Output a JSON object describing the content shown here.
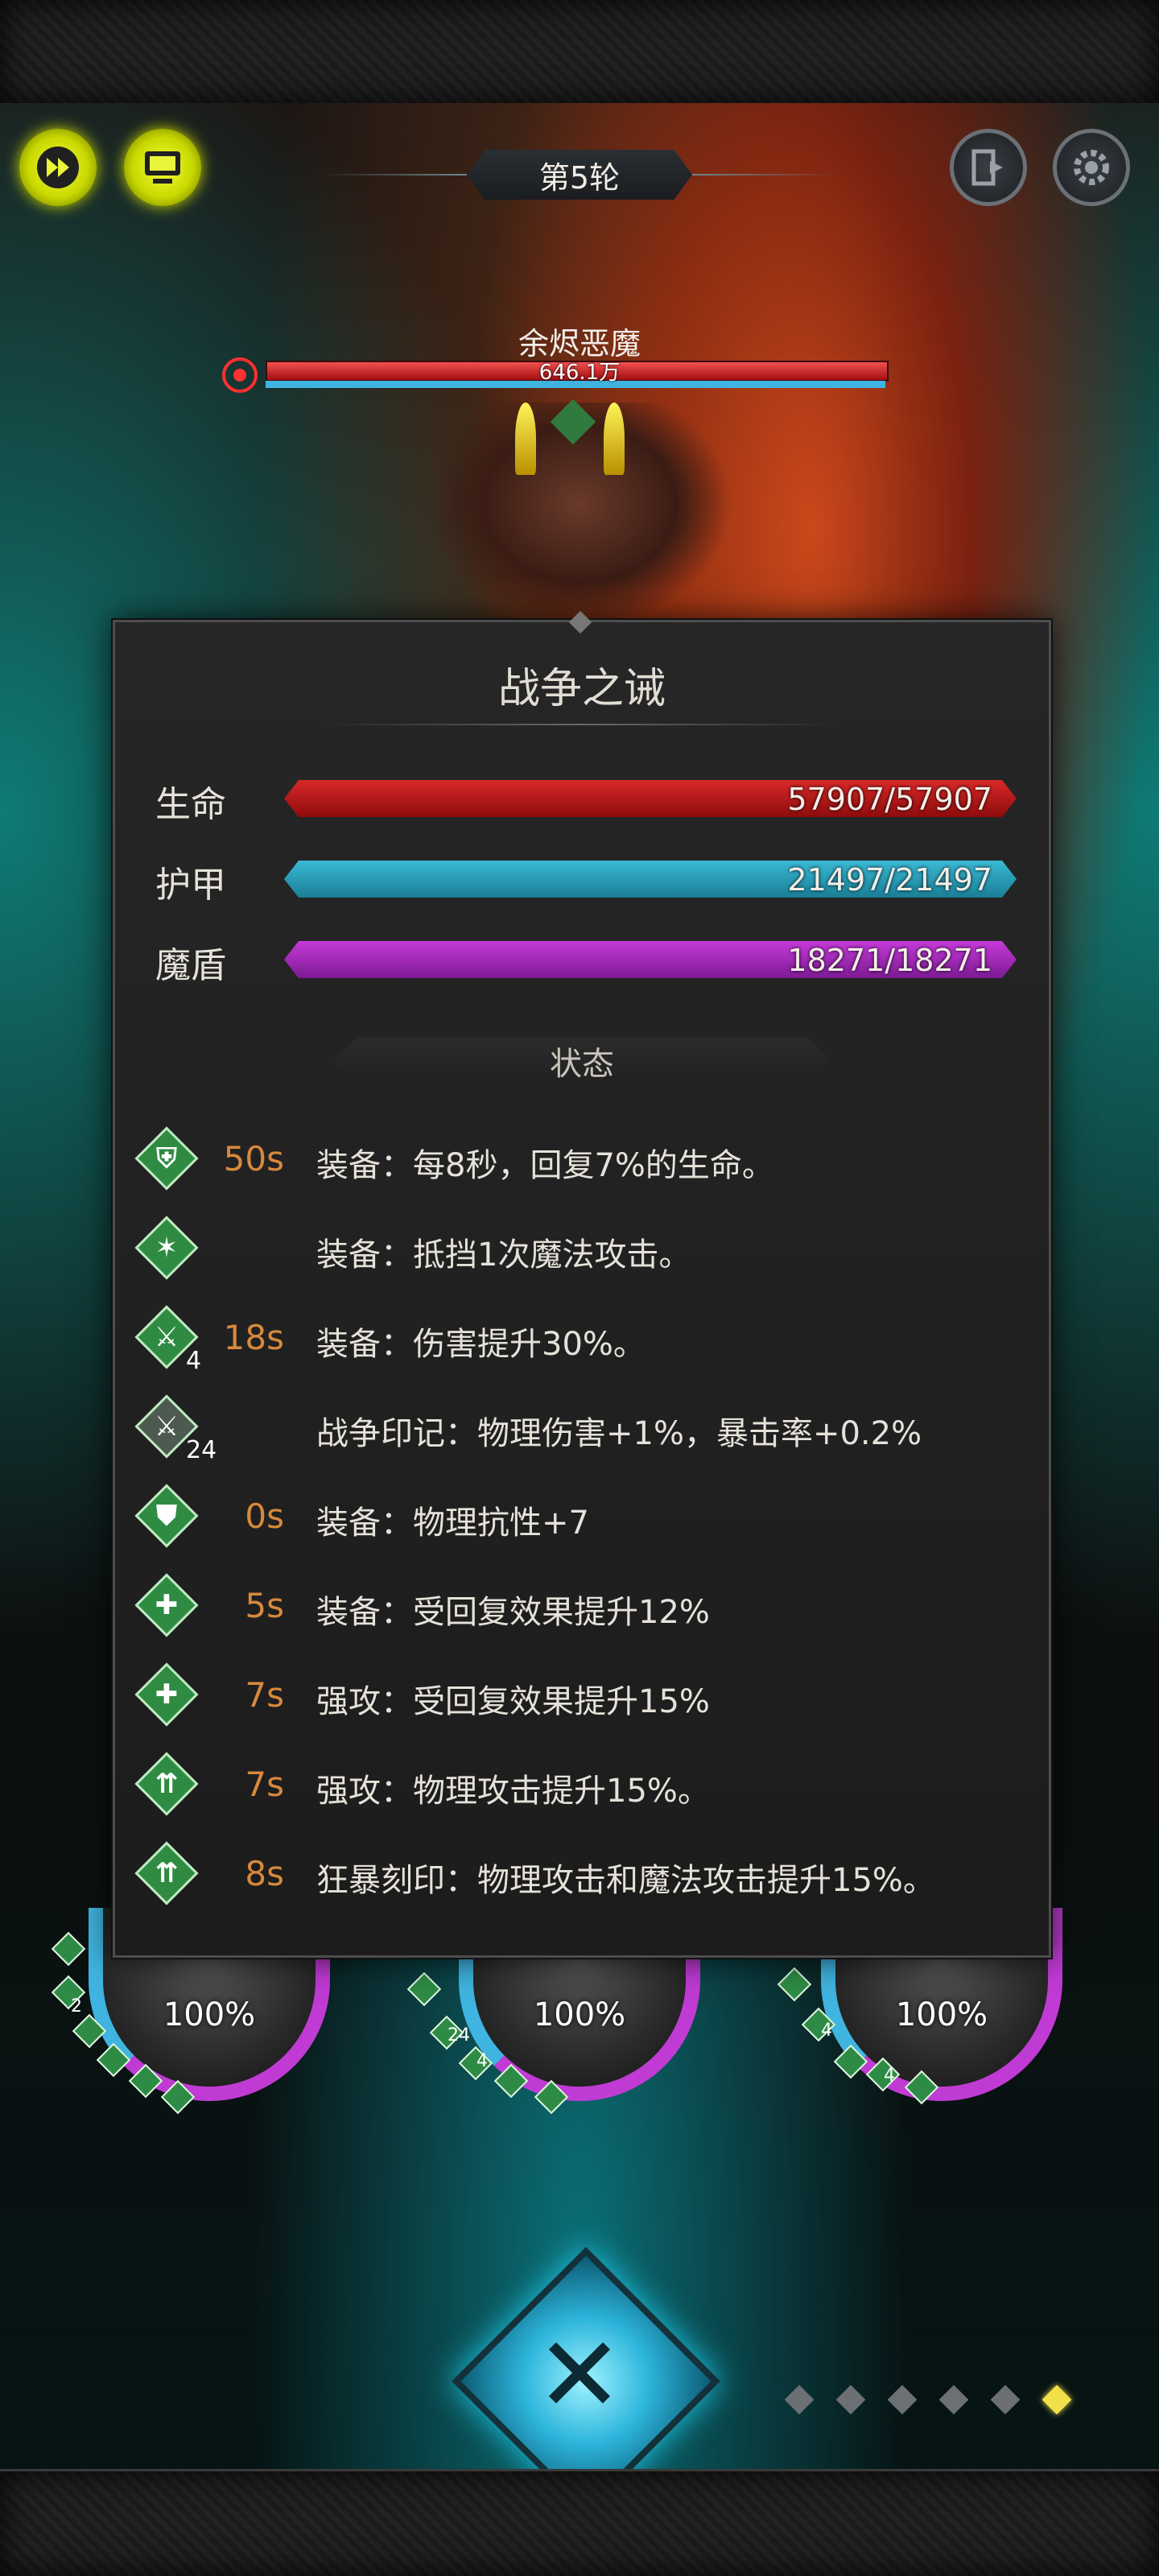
{
  "header": {
    "round_label": "第5轮"
  },
  "boss": {
    "name": "余烬恶魔",
    "hp_text": "646.1万"
  },
  "modal": {
    "title": "战争之诫",
    "stats": [
      {
        "label": "生命",
        "value": "57907/57907",
        "color": "#d82828"
      },
      {
        "label": "护甲",
        "value": "21497/21497",
        "color": "#3ab9d4"
      },
      {
        "label": "魔盾",
        "value": "18271/18271",
        "color": "#c43ad8"
      }
    ],
    "status_header": "状态",
    "statuses": [
      {
        "icon": "shield-heal-icon",
        "stack": "",
        "time": "50s",
        "text": "装备：每8秒，回复7%的生命。"
      },
      {
        "icon": "magic-block-icon",
        "stack": "",
        "time": "",
        "text": "装备：抵挡1次魔法攻击。"
      },
      {
        "icon": "damage-up-icon",
        "stack": "4",
        "time": "18s",
        "text": "装备：伤害提升30%。"
      },
      {
        "icon": "war-mark-icon",
        "stack": "24",
        "time": "",
        "text": "战争印记：物理伤害+1%，暴击率+0.2%"
      },
      {
        "icon": "shield-icon",
        "stack": "",
        "time": "0s",
        "text": "装备：物理抗性+7"
      },
      {
        "icon": "heal-up-icon",
        "stack": "",
        "time": "5s",
        "text": "装备：受回复效果提升12%"
      },
      {
        "icon": "heal-up-icon",
        "stack": "",
        "time": "7s",
        "text": "强攻：受回复效果提升15%"
      },
      {
        "icon": "attack-up-icon",
        "stack": "",
        "time": "7s",
        "text": "强攻：物理攻击提升15%。"
      },
      {
        "icon": "attack-up-icon",
        "stack": "",
        "time": "8s",
        "text": "狂暴刻印：物理攻击和魔法攻击提升15%。"
      }
    ]
  },
  "team": [
    {
      "percent": "100%",
      "buff_counts": [
        "2"
      ]
    },
    {
      "percent": "100%",
      "buff_counts": [
        "24",
        "4"
      ]
    },
    {
      "percent": "100%",
      "buff_counts": [
        "4",
        "4"
      ]
    }
  ],
  "pager": {
    "active_index": 5,
    "count": 6
  }
}
